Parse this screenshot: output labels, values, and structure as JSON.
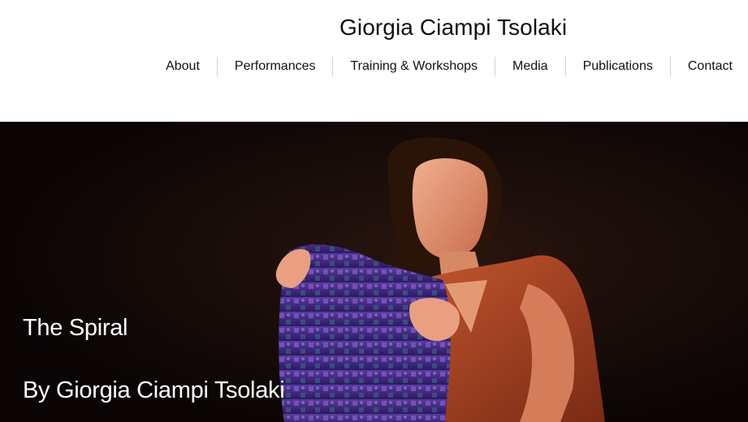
{
  "site": {
    "title": "Giorgia Ciampi Tsolaki"
  },
  "nav": {
    "items": [
      {
        "label": "About"
      },
      {
        "label": "Performances"
      },
      {
        "label": "Training & Workshops"
      },
      {
        "label": "Media"
      },
      {
        "label": "Publications"
      },
      {
        "label": "Contact"
      }
    ]
  },
  "hero": {
    "title": "The Spiral",
    "subtitle": "By Giorgia Ciampi Tsolaki",
    "image": "performer-photo",
    "background_color": "#0b0605"
  }
}
